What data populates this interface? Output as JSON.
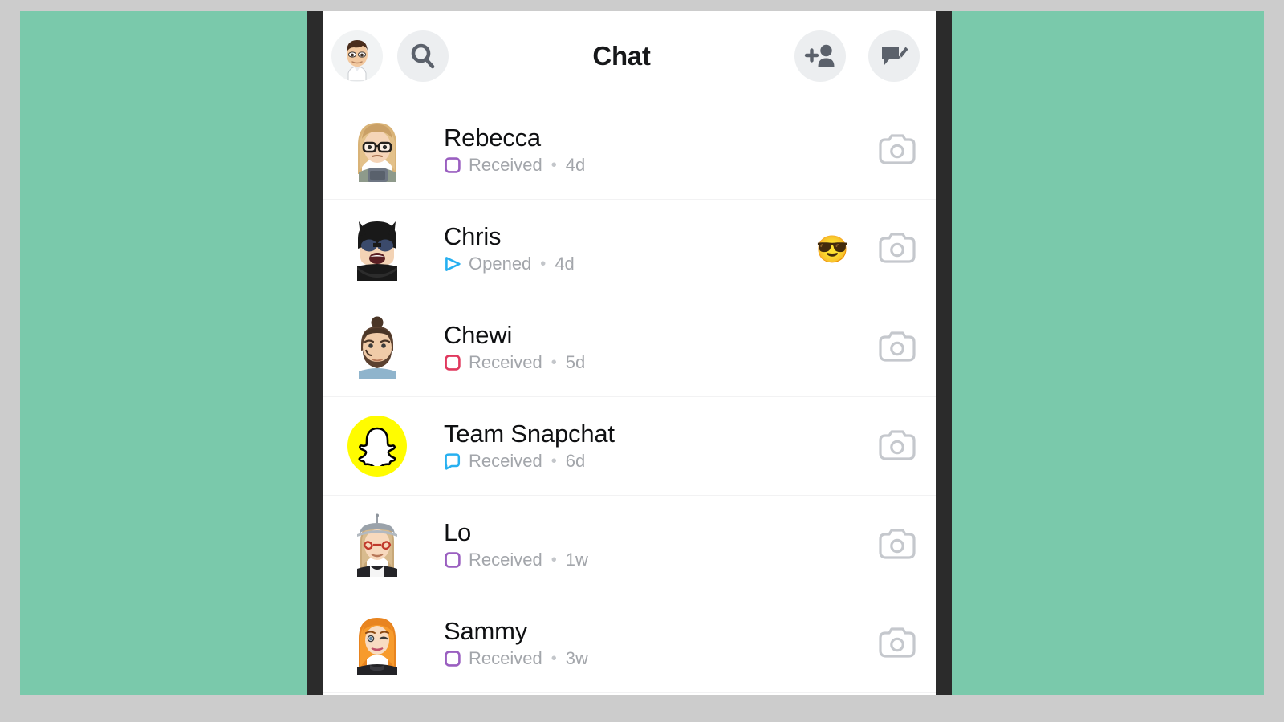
{
  "window": {
    "outer_bg": "#cccccc",
    "backdrop_color": "#7ac9ab",
    "device_bezel_color": "#2b2b2b",
    "screen_bg": "#ffffff"
  },
  "header": {
    "title": "Chat",
    "profile_avatar_name": "bitmoji-avatar",
    "search_icon": "search-icon",
    "add_friend_icon": "add-friend-icon",
    "new_chat_icon": "new-chat-icon"
  },
  "colors": {
    "status_purple": "#9a5fc0",
    "status_red": "#e0395e",
    "status_blue": "#27b0f0",
    "snap_yellow": "#fffc00",
    "camera_gray": "#c5c8cd",
    "text_primary": "#0f1012",
    "text_muted": "#a3a6ab"
  },
  "chats": [
    {
      "name": "Rebecca",
      "status": "Received",
      "time": "4d",
      "status_icon": "square-outline-icon",
      "status_color": "#9a5fc0",
      "avatar": "bitmoji-rebecca",
      "emoji": "",
      "camera_icon": "camera-icon"
    },
    {
      "name": "Chris",
      "status": "Opened",
      "time": "4d",
      "status_icon": "arrow-outline-icon",
      "status_color": "#27b0f0",
      "avatar": "bitmoji-chris-batman",
      "emoji": "😎",
      "camera_icon": "camera-icon"
    },
    {
      "name": "Chewi",
      "status": "Received",
      "time": "5d",
      "status_icon": "square-outline-icon",
      "status_color": "#e0395e",
      "avatar": "bitmoji-chewi",
      "emoji": "",
      "camera_icon": "camera-icon"
    },
    {
      "name": "Team Snapchat",
      "status": "Received",
      "time": "6d",
      "status_icon": "chat-bubble-outline-icon",
      "status_color": "#27b0f0",
      "avatar": "snapchat-ghost-logo",
      "emoji": "",
      "camera_icon": "camera-icon"
    },
    {
      "name": "Lo",
      "status": "Received",
      "time": "1w",
      "status_icon": "square-outline-icon",
      "status_color": "#9a5fc0",
      "avatar": "bitmoji-lo",
      "emoji": "",
      "camera_icon": "camera-icon"
    },
    {
      "name": "Sammy",
      "status": "Received",
      "time": "3w",
      "status_icon": "square-outline-icon",
      "status_color": "#9a5fc0",
      "avatar": "bitmoji-sammy",
      "emoji": "",
      "camera_icon": "camera-icon"
    }
  ]
}
